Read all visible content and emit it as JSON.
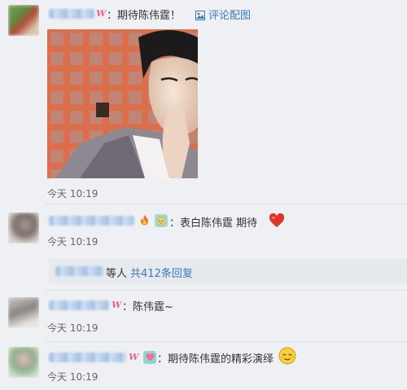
{
  "comments": [
    {
      "text": "：期待陈伟霆！",
      "attach_label": "评论配图",
      "time": "今天 10:19",
      "vip_mark": "W"
    },
    {
      "text": "：表白陈伟霆  期待",
      "time": "今天 10:19",
      "reply_summary": {
        "who": "等人",
        "count": "共412条回复"
      }
    },
    {
      "text": "：陈伟霆~",
      "time": "今天 10:19",
      "vip_mark": "W"
    },
    {
      "text": "：期待陈伟霆的精彩演绎",
      "time": "今天 10:19",
      "vip_mark": "W"
    }
  ],
  "icons": {
    "attach": "image-icon",
    "heart": "heart-icon",
    "cat": "cat-emoji-icon",
    "fire": "fire-emoji-icon",
    "relieved": "relieved-face-icon",
    "heart_badge": "heart-badge-icon"
  },
  "colors": {
    "link": "#3a7abd",
    "vip": "#e9649b",
    "heart": "#e0342c",
    "background": "#eef0f3"
  }
}
